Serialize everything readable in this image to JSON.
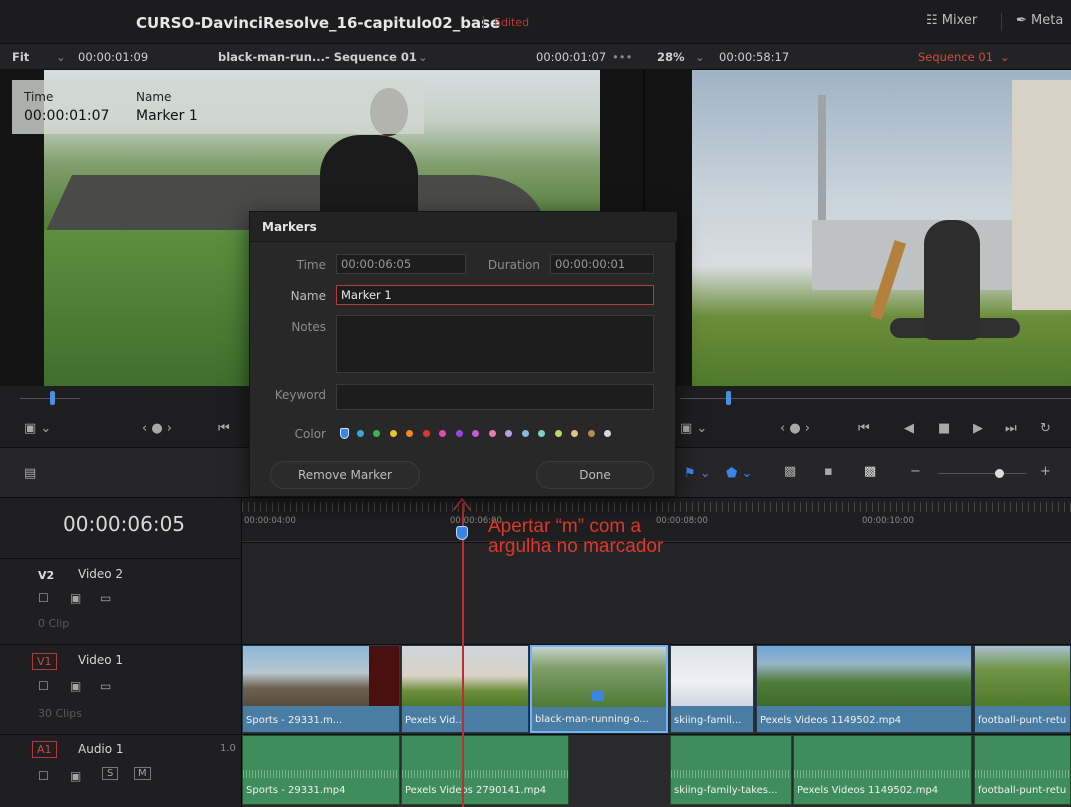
{
  "window": {
    "title": "CURSO-DavinciResolve_16-capitulo02_base",
    "status": "Edited",
    "mixer_label": "Mixer",
    "meta_label": "Meta"
  },
  "viewer": {
    "zoom_left": "Fit",
    "source_timecode": "00:00:01:09",
    "source_clip": "black-man-run...- Sequence 01",
    "source_duration": "00:00:01:07",
    "zoom_right": "28%",
    "program_timecode": "00:00:58:17",
    "program_sequence": "Sequence 01"
  },
  "overlay": {
    "time_label": "Time",
    "time_value": "00:00:01:07",
    "name_label": "Name",
    "name_value": "Marker 1"
  },
  "markers_dialog": {
    "title": "Markers",
    "time_label": "Time",
    "time_value": "00:00:06:05",
    "duration_label": "Duration",
    "duration_value": "00:00:00:01",
    "name_label": "Name",
    "name_value": "Marker 1",
    "notes_label": "Notes",
    "keyword_label": "Keyword",
    "color_label": "Color",
    "colors": [
      "#3a86e8",
      "#33a9d6",
      "#3bb54a",
      "#e8c32b",
      "#f08a24",
      "#e0372b",
      "#e04aa3",
      "#9b46d9",
      "#c45bd4",
      "#e87bb6",
      "#b3a3e0",
      "#8fb5e0",
      "#7fd0c0",
      "#b5d96b",
      "#e0c48a",
      "#b08a5a",
      "#d8d8d8"
    ],
    "remove_button": "Remove Marker",
    "done_button": "Done"
  },
  "timeline": {
    "current_timecode": "00:00:06:05",
    "ruler_ticks": [
      "00:00:04:00",
      "00:00:06:00",
      "00:00:08:00",
      "00:00:10:00"
    ],
    "annotation": [
      "Apertar “m” com a",
      "argulha no marcador"
    ],
    "tracks": {
      "v2": {
        "id": "V2",
        "name": "Video 2",
        "info": "0 Clip"
      },
      "v1": {
        "id": "V1",
        "name": "Video 1",
        "info": "30 Clips"
      },
      "a1": {
        "id": "A1",
        "name": "Audio 1",
        "level": "1.0"
      }
    },
    "video_clips": [
      "Sports - 29331.m...",
      "Pexels Vid...",
      "black-man-running-o...",
      "skiing-famil...",
      "Pexels Videos 1149502.mp4",
      "football-punt-retu"
    ],
    "audio_clips": [
      "Sports - 29331.mp4",
      "Pexels Videos 2790141.mp4",
      "skiing-family-takes...",
      "Pexels Videos 1149502.mp4",
      "football-punt-retu"
    ]
  }
}
